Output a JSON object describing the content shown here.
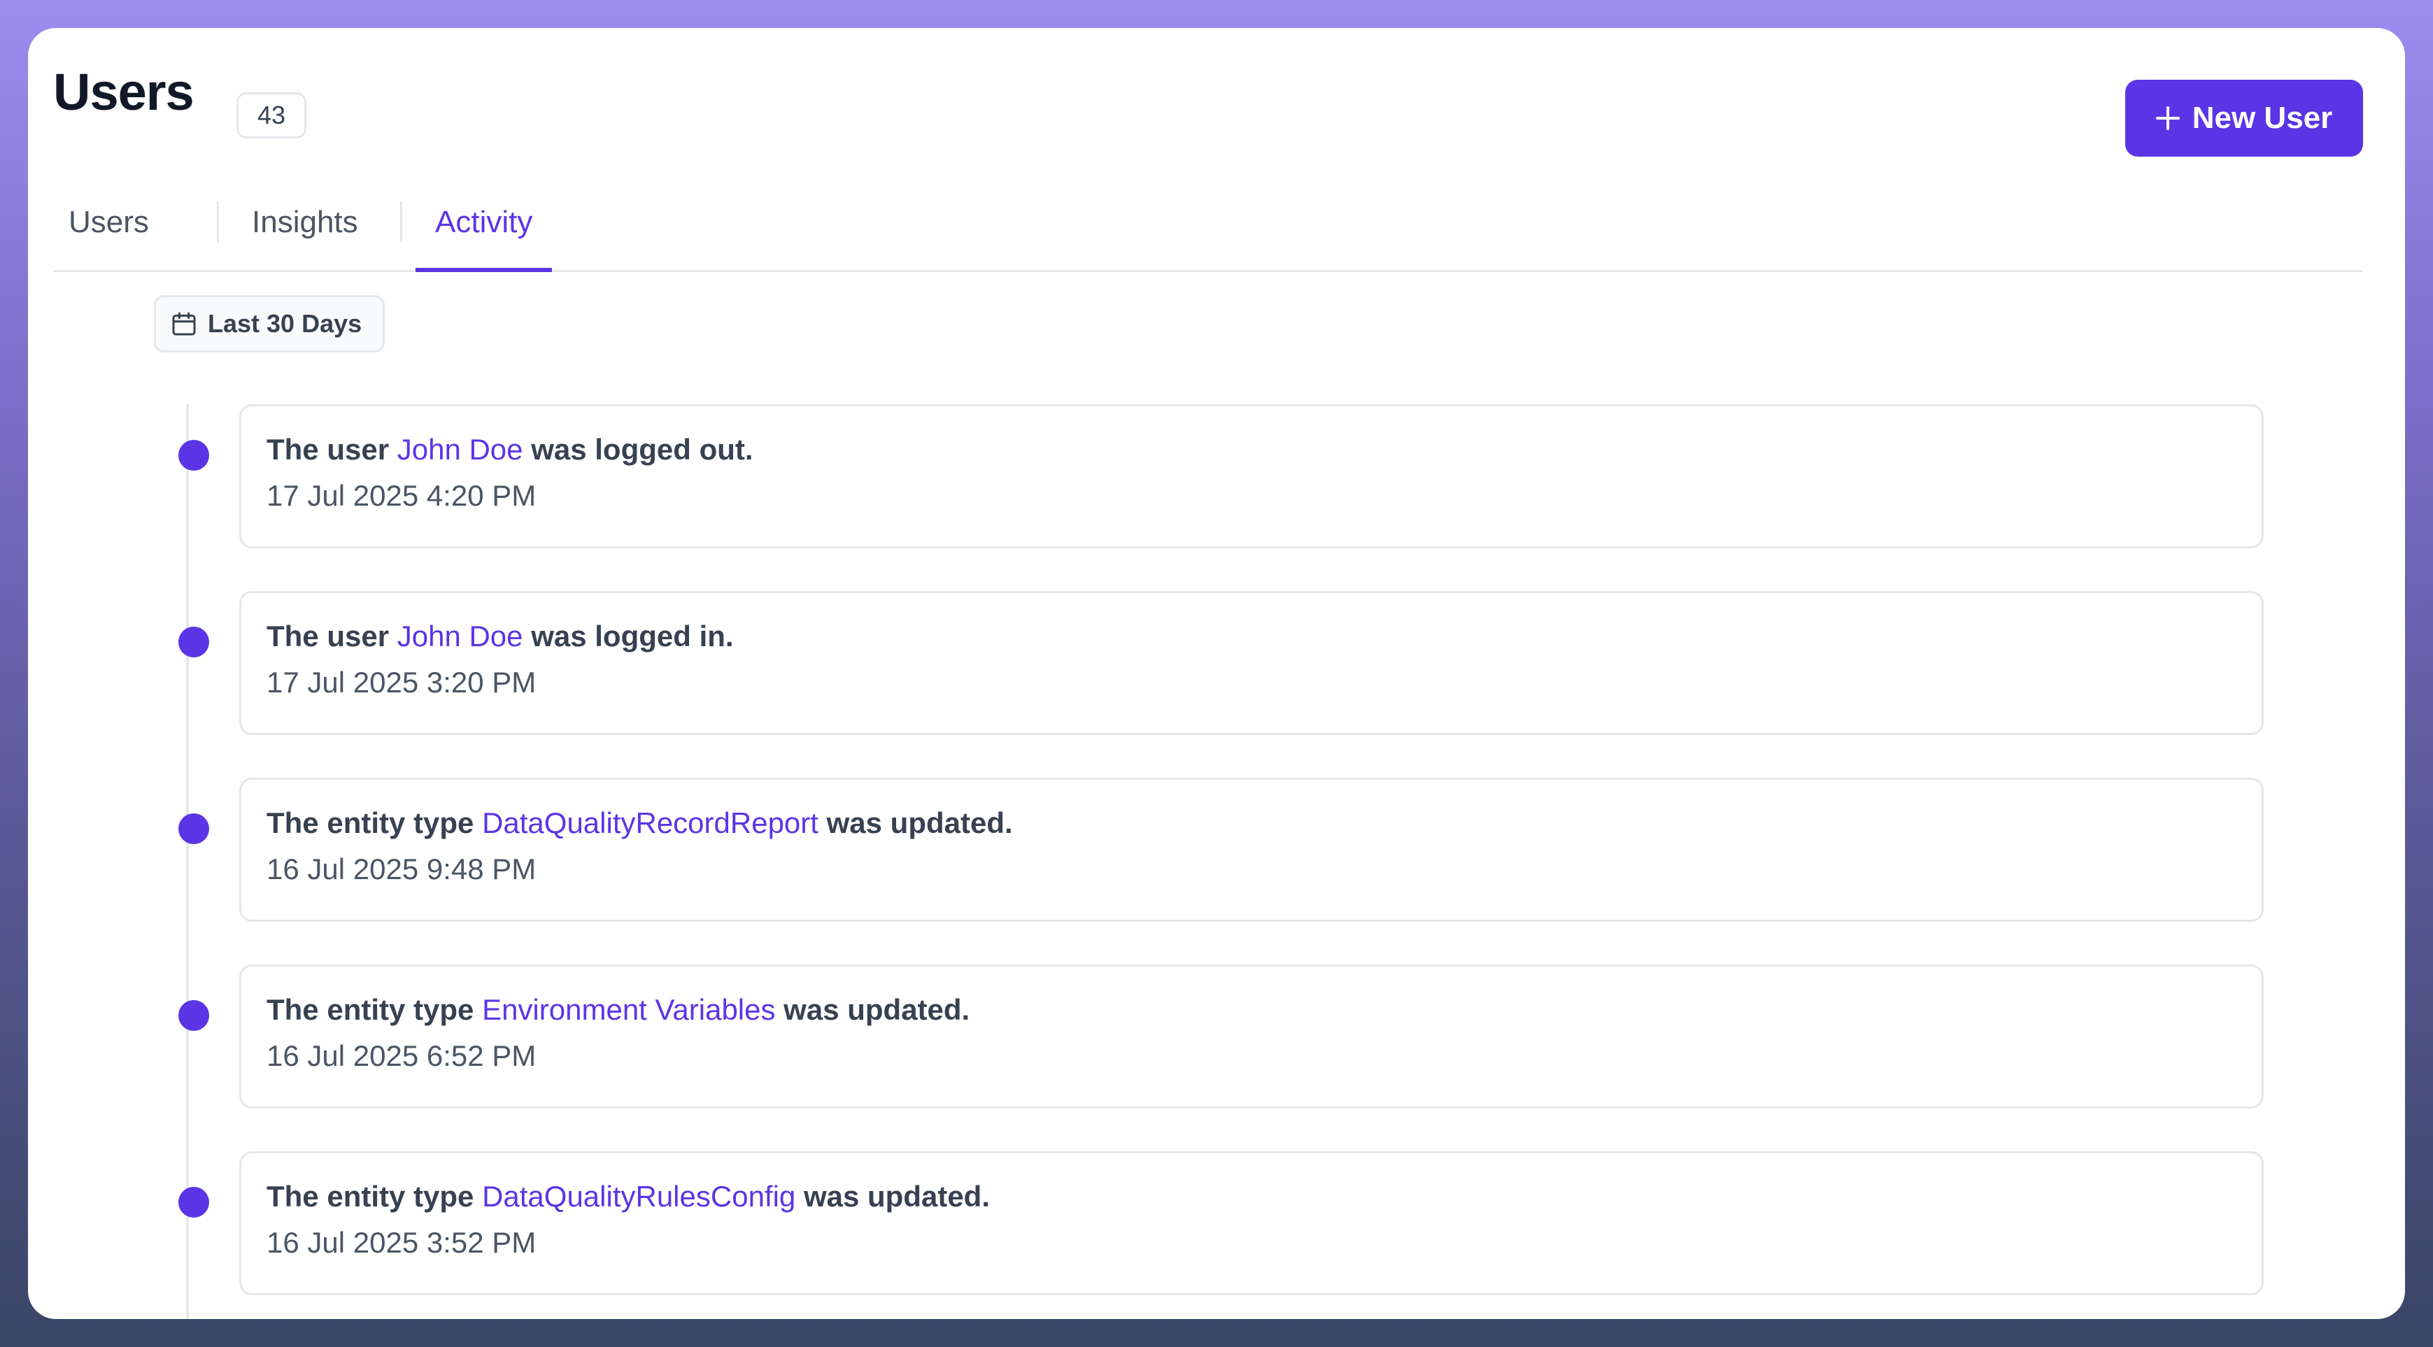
{
  "header": {
    "title": "Users",
    "count": "43",
    "new_user_label": "New User"
  },
  "tabs": [
    {
      "label": "Users",
      "active": false
    },
    {
      "label": "Insights",
      "active": false
    },
    {
      "label": "Activity",
      "active": true
    }
  ],
  "filter": {
    "date_range": "Last 30 Days",
    "icon": "calendar-icon"
  },
  "events": [
    {
      "prefix": "The user ",
      "entity": "John Doe",
      "suffix": " was logged out.",
      "time": "17 Jul 2025 4:20 PM"
    },
    {
      "prefix": "The user ",
      "entity": "John Doe",
      "suffix": " was logged in.",
      "time": "17 Jul 2025 3:20 PM"
    },
    {
      "prefix": "The entity type ",
      "entity": "DataQualityRecordReport",
      "suffix": " was updated.",
      "time": "16 Jul 2025 9:48 PM"
    },
    {
      "prefix": "The entity type ",
      "entity": "Environment Variables",
      "suffix": " was updated.",
      "time": "16 Jul 2025 6:52 PM"
    },
    {
      "prefix": "The entity type ",
      "entity": "DataQualityRulesConfig",
      "suffix": " was updated.",
      "time": "16 Jul 2025 3:52 PM"
    }
  ],
  "colors": {
    "accent": "#5b35e5",
    "text": "#374151",
    "border": "#e5e7eb"
  }
}
